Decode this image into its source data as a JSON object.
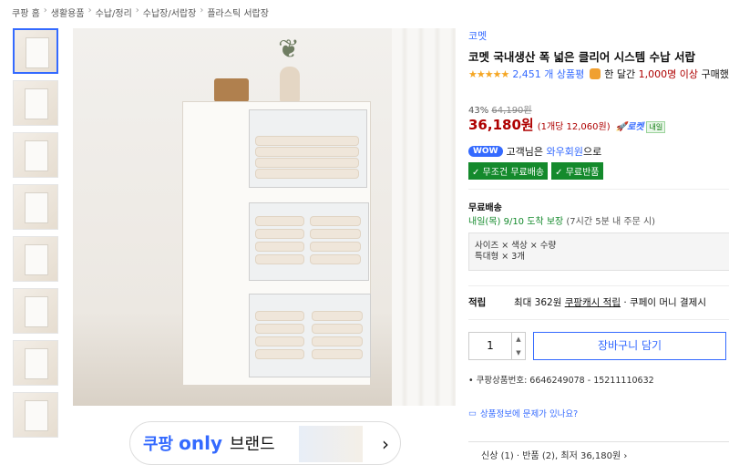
{
  "breadcrumb": [
    "쿠팡 홈",
    "생활용품",
    "수납/정리",
    "수납장/서랍장",
    "플라스틱 서랍장"
  ],
  "thumbnails": 8,
  "banner": {
    "logo": "쿠팡",
    "only": "only",
    "text": "브랜드"
  },
  "product": {
    "brand": "코멧",
    "title": "코멧 국내생산 폭 넓은 클리어 시스템 수납 서랍",
    "rating_stars": 4.5,
    "review_count": "2,451 개 상품평",
    "monthly_pre": "한 달간",
    "monthly_count": "1,000명 이상",
    "monthly_post": "구매했",
    "discount": "43%",
    "original_price": "64,190원",
    "price": "36,180원",
    "unit_price": "(1개당 12,060원)",
    "rocket": "로켓",
    "naeil": "내일",
    "wow_badge": "WOW",
    "wow_pre": "고객님은",
    "wow_link": "와우회원",
    "wow_post": "으로",
    "chip1": "✓ 무조건 무료배송",
    "chip2": "✓ 무료반품",
    "shipping_title": "무료배송",
    "shipping_date": "내일(목) 9/10",
    "shipping_guarantee": "도착 보장",
    "shipping_note": "(7시간 5분 내 주문 시)",
    "option_line1": "사이즈 × 색상 × 수량",
    "option_line2": "특대형 × 3개",
    "reward_label": "적립",
    "reward_max": "최대 362원",
    "reward_link": "쿠팡캐시 적립",
    "reward_rest": "· 쿠페이 머니 결제시",
    "qty": "1",
    "cart_label": "장바구니 담기",
    "product_id": "• 쿠팡상품번호: 6646249078 - 15211110632",
    "report_text": "상품정보에 문제가 있나요?",
    "bottom_tab": "신상 (1) · 반품 (2), 최저 36,180원 ›"
  },
  "colors": {
    "accent": "#346aff",
    "price": "#ae0000",
    "green": "#148a2c"
  }
}
